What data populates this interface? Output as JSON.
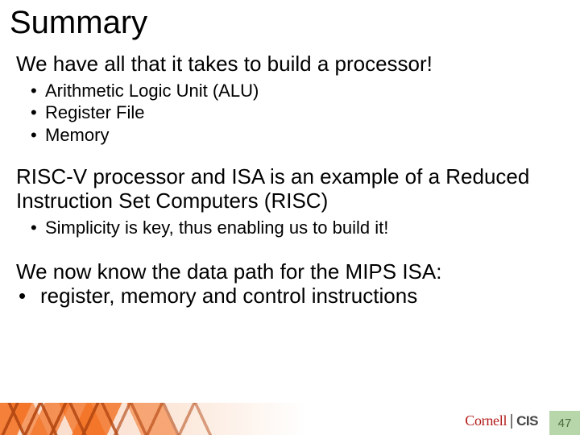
{
  "title": "Summary",
  "section1": {
    "lead": "We have all that it takes to build a processor!",
    "bullets": [
      "Arithmetic Logic Unit (ALU)",
      "Register File",
      "Memory"
    ]
  },
  "section2": {
    "lead": "RISC-V processor and ISA is an example of a Reduced Instruction Set Computers (RISC)",
    "bullets": [
      "Simplicity is key, thus enabling us to build it!"
    ]
  },
  "section3": {
    "lead": "We now know the data path for the MIPS ISA:",
    "bullet": "register, memory and control instructions"
  },
  "footer": {
    "logo_left": "Cornell",
    "logo_right": "CIS",
    "page_number": "47"
  }
}
